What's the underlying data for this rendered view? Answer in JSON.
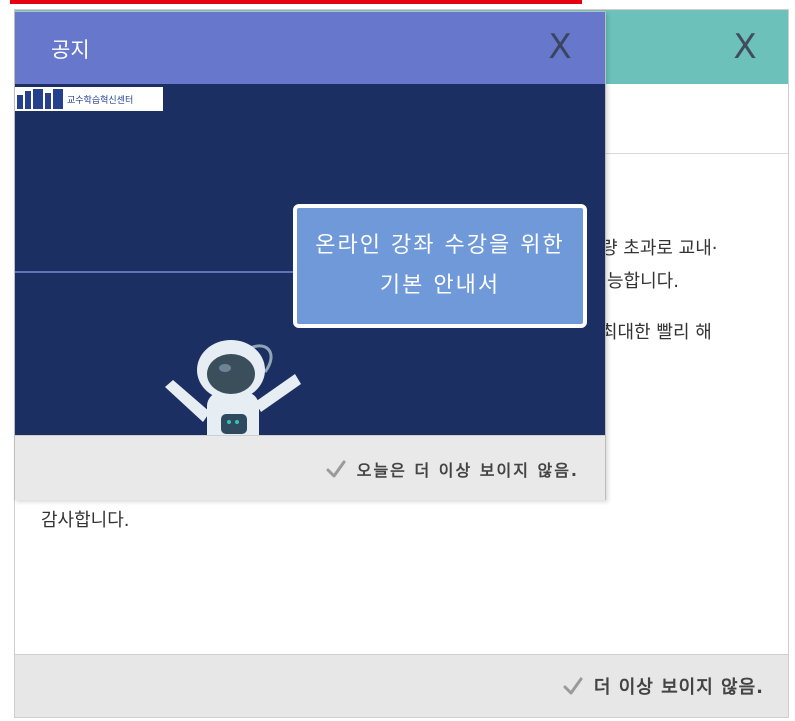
{
  "back_popup": {
    "close_label": "X",
    "body_lines": [
      "량 초과로 교내·",
      "능합니다.",
      "최대한 빨리 해"
    ],
    "thanks": "감사합니다.",
    "footer_label": "더 이상 보이지 않음."
  },
  "front_popup": {
    "title": "공지",
    "close_label": "X",
    "banner": {
      "logo_text": "교수학습혁신센터",
      "card_line1": "온라인 강좌 수강을 위한",
      "card_line2": "기본 안내서"
    },
    "footer_label": "오늘은 더 이상 보이지 않음."
  },
  "colors": {
    "front_header": "#6677cc",
    "back_header": "#6cc2bb",
    "banner_bg": "#1c2f63",
    "card_bg": "#6f99d8",
    "top_border": "#e50012"
  }
}
